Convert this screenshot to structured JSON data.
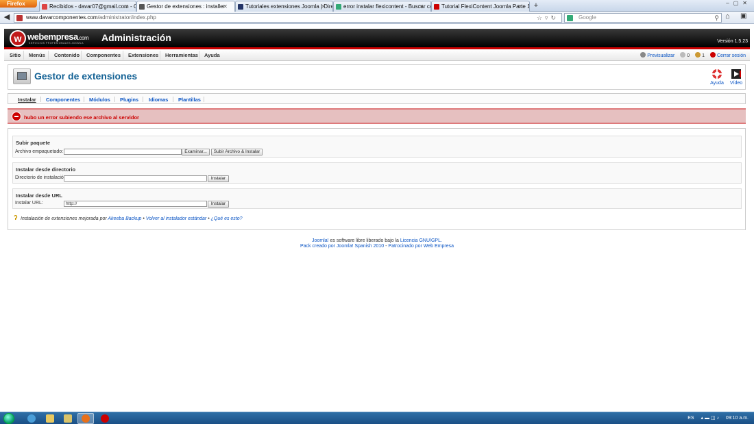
{
  "browser": {
    "app_button": "Firefox",
    "tabs": [
      {
        "title": "Recibidos - davar07@gmail.com - G...",
        "color": "#d44"
      },
      {
        "title": "Gestor de extensiones : installer",
        "color": "#555"
      },
      {
        "title": "Tutoriales extensiones Joomla | Direct...",
        "color": "#236"
      },
      {
        "title": "error instalar flexicontent - Buscar co...",
        "color": "#3a7"
      },
      {
        "title": "Tutorial FlexiContent Joomla Parte 1/...",
        "color": "#c00"
      }
    ],
    "url_domain": "www.davarcomponentes.com",
    "url_path": "/administrator/index.php",
    "search_placeholder": "Google"
  },
  "header": {
    "logo_text": "webempresa",
    "logo_suffix": ".com",
    "logo_sub": "SERVICIOS PROFESIONALES JOOMLA",
    "title": "Administración",
    "version": "Versión 1.5.23"
  },
  "menu": {
    "items": [
      "Sitio",
      "Menús",
      "Contenido",
      "Componentes",
      "Extensiones",
      "Herramientas",
      "Ayuda"
    ],
    "preview": "Previsualizar",
    "messages_count": "0",
    "users_count": "1",
    "logout": "Cerrar sesión"
  },
  "toolbar": {
    "page_title": "Gestor de extensiones",
    "help_label": "Ayuda",
    "video_label": "Vídeo"
  },
  "subnav": {
    "items": [
      "Instalar",
      "Componentes",
      "Módulos",
      "Plugins",
      "Idiomas",
      "Plantillas"
    ]
  },
  "error": {
    "message": "hubo un error subiendo ese archivo al servidor"
  },
  "install": {
    "upload": {
      "heading": "Subir paquete",
      "label": "Archivo empaquetado:",
      "browse_label": "Examinar...",
      "submit_label": "Subir Archivo & Instalar"
    },
    "directory": {
      "heading": "Instalar desde directorio",
      "label": "Directorio de instalación:",
      "value": "",
      "button_label": "Instalar"
    },
    "url": {
      "heading": "Instalar desde URL",
      "label": "Instalar URL:",
      "value": "http://",
      "button_label": "Instalar"
    },
    "note": {
      "prefix": "Instalación de extensiones mejorada por",
      "link1": "Akeeba Backup",
      "sep": "•",
      "link2": "Volver al instalador estándar",
      "link3": "¿Qué es esto?"
    }
  },
  "footer": {
    "joomla": "Joomla!",
    "line1_text": "es software libre liberado bajo la",
    "license": "Licencia GNU/GPL.",
    "line2_link": "Pack creado por Joomla! Spanish 2010",
    "line2_sep": " - ",
    "line2_link2": "Patrocinado por Web Empresa"
  },
  "taskbar": {
    "lang": "ES",
    "time": "09:10 a.m."
  }
}
